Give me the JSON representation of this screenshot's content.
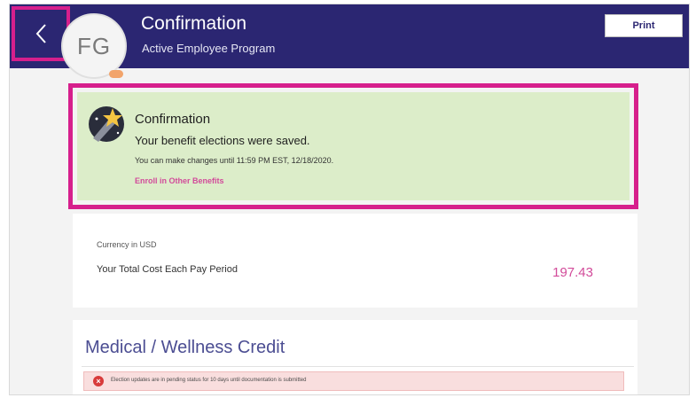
{
  "header": {
    "back_icon": "chevron-left-icon",
    "avatar_initials": "FG",
    "title": "Confirmation",
    "subtitle": "Active Employee Program",
    "print_label": "Print",
    "background": "#2b2672"
  },
  "confirmation": {
    "icon": "star-icon",
    "title": "Confirmation",
    "message": "Your benefit elections were saved.",
    "deadline": "You can make changes until 11:59 PM EST, 12/18/2020.",
    "link_label": "Enroll in Other Benefits",
    "background": "#dcedc9"
  },
  "cost": {
    "currency": "Currency in USD",
    "label": "Your Total Cost Each Pay Period",
    "value": "197.43"
  },
  "medical": {
    "title": "Medical / Wellness Credit",
    "alert_icon": "error-icon",
    "alert_text": "Election updates are in pending status for 10 days until documentation is submitted"
  },
  "colors": {
    "highlight": "#d61f8c",
    "accent_pink": "#d24b9a",
    "medical_title": "#4b4d92"
  }
}
